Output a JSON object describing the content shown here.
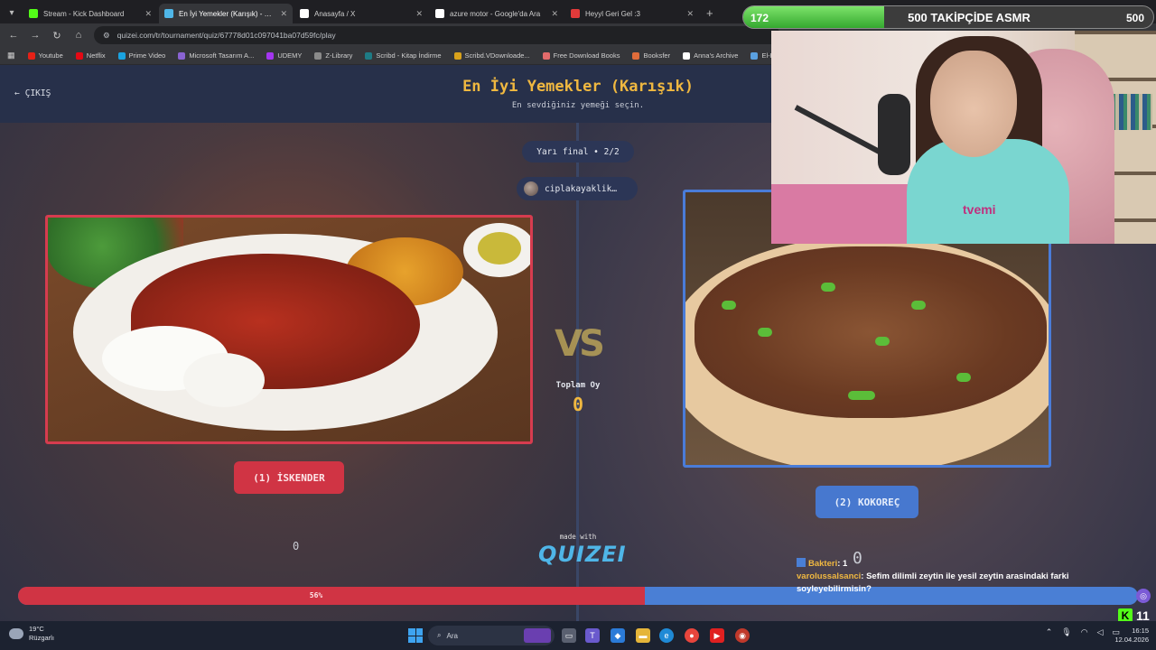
{
  "browser": {
    "tabs": [
      {
        "label": "Stream - Kick Dashboard",
        "icon": "kick-icon",
        "icon_color": "#53fc18",
        "active": false
      },
      {
        "label": "En İyi Yemekler (Karışık) - Tier Lis...",
        "icon": "quizei-icon",
        "icon_color": "#4fb6e8",
        "active": true
      },
      {
        "label": "Anasayfa / X",
        "icon": "x-icon",
        "icon_color": "#ffffff",
        "active": false
      },
      {
        "label": "azure motor - Google'da Ara",
        "icon": "google-icon",
        "icon_color": "#ffffff",
        "active": false
      },
      {
        "label": "Heyyl Geri Gel :3",
        "icon": "u-icon",
        "icon_color": "#e23a3a",
        "active": false
      }
    ],
    "url": "quizei.com/tr/tournament/quiz/67778d01c097041ba07d59fc/play",
    "bookmarks": [
      {
        "label": "Youtube",
        "color": "#e62117"
      },
      {
        "label": "Netflix",
        "color": "#e50914"
      },
      {
        "label": "Prime Video",
        "color": "#1aa3e0"
      },
      {
        "label": "Microsoft Tasarım A...",
        "color": "#8a63d2"
      },
      {
        "label": "UDEMY",
        "color": "#a435f0"
      },
      {
        "label": "Z-Library",
        "color": "#8a8a8a"
      },
      {
        "label": "Scribd - Kitap İndirme",
        "color": "#1e7b85"
      },
      {
        "label": "Scribd.VDownloade...",
        "color": "#d9a21b"
      },
      {
        "label": "Free Download Books",
        "color": "#e36b6b"
      },
      {
        "label": "Booksfer",
        "color": "#e06c3a"
      },
      {
        "label": "Anna's Archive",
        "color": "#ffffff"
      },
      {
        "label": "El-Ki",
        "color": "#5aa0e0"
      }
    ]
  },
  "quiz": {
    "exit_label": "ÇIKIŞ",
    "title": "En İyi Yemekler (Karışık)",
    "subtitle": "En sevdiğiniz yemeği seçin.",
    "round": "Yarı final • 2/2",
    "creator": "ciplakayaklik…",
    "vote_label": "Toplam Oy",
    "vote_count": "0",
    "vs": "VS",
    "left_choice": "(1) İSKENDER",
    "right_choice": "(2) KOKOREÇ",
    "made_with": "made with",
    "logo": "QUIZEI",
    "progress_percent": 56,
    "progress_label": "56%",
    "ghost_left": "0",
    "ghost_right": "0"
  },
  "overlay": {
    "left_count": "172",
    "goal_text": "500 TAKİPÇİDE ASMR",
    "right_count": "500",
    "progress_fraction": 0.344,
    "shirt_text": "tvemi"
  },
  "chat": [
    {
      "user": "Bakteri",
      "text": ": 1"
    },
    {
      "user": "varolussalsanci",
      "text": ": Sefim dilimli zeytin ile yesil zeytin arasindaki farki soyleyebilirmisin?"
    }
  ],
  "kick_count": "11",
  "taskbar": {
    "weather_temp": "19°C",
    "weather_desc": "Rüzgarlı",
    "search_placeholder": "Ara",
    "time": "16:15",
    "date": "12.04.2026"
  },
  "colors": {
    "red": "#d03444",
    "blue": "#4a7fd5",
    "gold": "#f0b840"
  }
}
